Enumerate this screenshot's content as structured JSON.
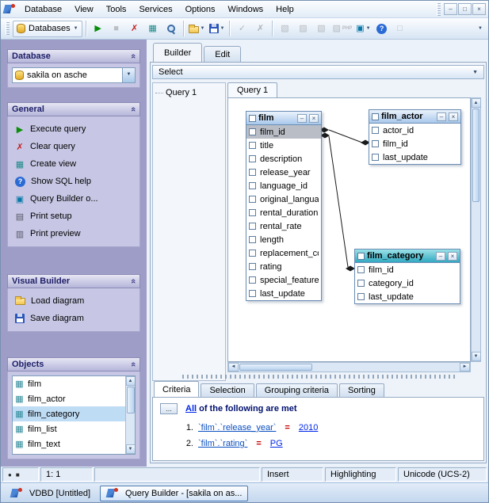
{
  "menubar": {
    "items": [
      "Database",
      "View",
      "Tools",
      "Services",
      "Options",
      "Windows",
      "Help"
    ]
  },
  "toolbar": {
    "databases_label": "Databases",
    "php_label": "PHP"
  },
  "icons": {
    "minimize": "–",
    "restore": "□",
    "close": "×",
    "dropdown": "▼",
    "execute": "▶",
    "stop": "■",
    "clear": "✗",
    "view": "▦",
    "apply": "✓",
    "cancel": "✗",
    "help": "?",
    "builder": "▣",
    "print_setup": "▤",
    "print_preview": "▥",
    "export": "▧",
    "window": "□",
    "collapse": "«",
    "table": "▦",
    "scroll_up": "▲",
    "scroll_down": "▼",
    "scroll_left": "◄",
    "scroll_right": "►",
    "select_chevron": "▼",
    "rec_circle": "●",
    "rec_square": "■",
    "tw_min": "–",
    "tw_close": "×"
  },
  "sidebar": {
    "database": {
      "title": "Database",
      "combo_value": "sakila on asche"
    },
    "general": {
      "title": "General",
      "items": [
        "Execute query",
        "Clear query",
        "Create view",
        "Show SQL help",
        "Query Builder o...",
        "Print setup",
        "Print preview"
      ]
    },
    "visual_builder": {
      "title": "Visual Builder",
      "items": [
        "Load diagram",
        "Save diagram"
      ]
    },
    "objects": {
      "title": "Objects",
      "items": [
        {
          "label": "film"
        },
        {
          "label": "film_actor"
        },
        {
          "label": "film_category",
          "selected": true
        },
        {
          "label": "film_list"
        },
        {
          "label": "film_text"
        }
      ]
    }
  },
  "main": {
    "tabs": [
      {
        "label": "Builder",
        "active": true
      },
      {
        "label": "Edit"
      }
    ],
    "select_bar": "Select",
    "tree_root": "Query 1",
    "query_tab": "Query 1",
    "diagram": {
      "tables": [
        {
          "name": "film",
          "fields": [
            {
              "label": "film_id",
              "highlight": true
            },
            {
              "label": "title"
            },
            {
              "label": "description"
            },
            {
              "label": "release_year"
            },
            {
              "label": "language_id"
            },
            {
              "label": "original_languag"
            },
            {
              "label": "rental_duration"
            },
            {
              "label": "rental_rate"
            },
            {
              "label": "length"
            },
            {
              "label": "replacement_co"
            },
            {
              "label": "rating"
            },
            {
              "label": "special_feature"
            },
            {
              "label": "last_update"
            }
          ]
        },
        {
          "name": "film_actor",
          "fields": [
            {
              "label": "actor_id"
            },
            {
              "label": "film_id"
            },
            {
              "label": "last_update"
            }
          ]
        },
        {
          "name": "film_category",
          "fields": [
            {
              "label": "film_id"
            },
            {
              "label": "category_id"
            },
            {
              "label": "last_update"
            }
          ]
        }
      ]
    },
    "criteria_tabs": [
      {
        "label": "Criteria",
        "active": true
      },
      {
        "label": "Selection"
      },
      {
        "label": "Grouping criteria"
      },
      {
        "label": "Sorting"
      }
    ],
    "criteria": {
      "ellipsis_button": "...",
      "all_link": "All",
      "header_rest": " of the following are met",
      "rows": [
        {
          "num": "1.",
          "expr": "`film`.`release_year`",
          "op": "=",
          "value": "2010"
        },
        {
          "num": "2.",
          "expr": "`film`.`rating`",
          "op": "=",
          "value": "PG"
        }
      ]
    }
  },
  "statusbar": {
    "position": "1:   1",
    "mode": "Insert",
    "highlight": "Highlighting",
    "encoding": "Unicode (UCS-2)"
  },
  "taskbar": {
    "items": [
      {
        "label": "VDBD [Untitled]"
      },
      {
        "label": "Query Builder - [sakila on as...",
        "active": true
      }
    ]
  }
}
